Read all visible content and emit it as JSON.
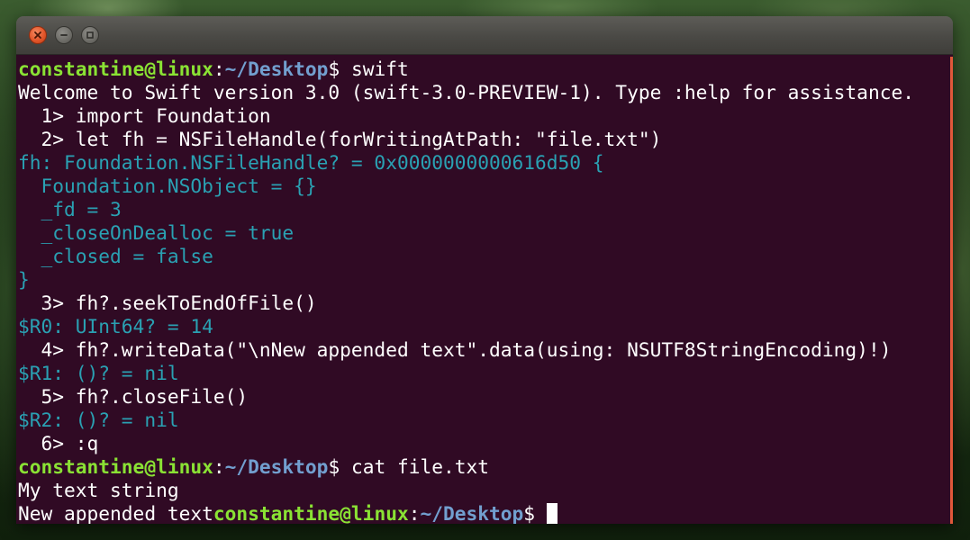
{
  "window": {
    "buttons": {
      "close": "close-icon",
      "minimize": "minimize-icon",
      "maximize": "maximize-icon"
    }
  },
  "colors": {
    "background": "#300a24",
    "prompt_user": "#8ae234",
    "prompt_path": "#729fcf",
    "output_teal": "#2aa1b3",
    "text": "#ffffff",
    "scroll_edge": "#e0573a"
  },
  "prompt": {
    "user_host": "constantine@linux",
    "colon": ":",
    "path": "~/Desktop",
    "symbol": "$ "
  },
  "lines": {
    "cmd1": "swift",
    "welcome": "Welcome to Swift version 3.0 (swift-3.0-PREVIEW-1). Type :help for assistance.",
    "in1": "  1> import Foundation",
    "in2": "  2> let fh = NSFileHandle(forWritingAtPath: \"file.txt\")",
    "out_fh": "fh: Foundation.NSFileHandle? = 0x0000000000616d50 {",
    "out_nsobject": "  Foundation.NSObject = {}",
    "out_fd": "  _fd = 3",
    "out_closeondealloc": "  _closeOnDealloc = true",
    "out_closed": "  _closed = false",
    "out_brace": "}",
    "in3": "  3> fh?.seekToEndOfFile()",
    "out_r0": "$R0: UInt64? = 14",
    "in4": "  4> fh?.writeData(\"\\nNew appended text\".data(using: NSUTF8StringEncoding)!)",
    "out_r1": "$R1: ()? = nil",
    "in5": "  5> fh?.closeFile()",
    "out_r2": "$R2: ()? = nil",
    "in6": "  6> :q",
    "cmd2": "cat file.txt",
    "file_line1": "My text string",
    "file_line2": "New appended text"
  }
}
